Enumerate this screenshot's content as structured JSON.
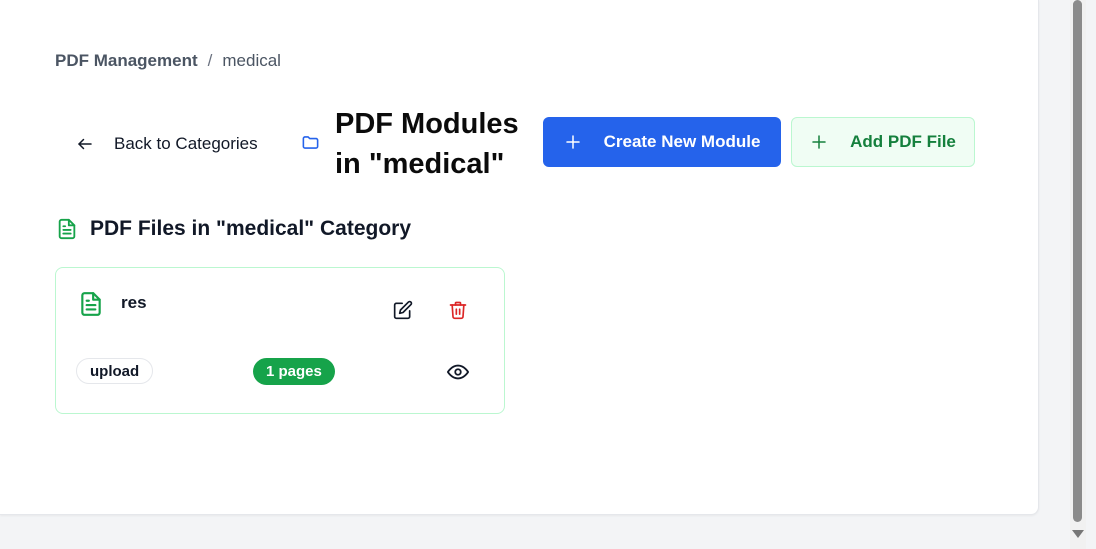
{
  "breadcrumb": {
    "root": "PDF Management",
    "separator": "/",
    "current": "medical"
  },
  "header": {
    "back_label": "Back to Categories",
    "title": "PDF Modules in \"medical\"",
    "create_label": "Create New Module",
    "add_label": "Add PDF File"
  },
  "section": {
    "heading": "PDF Files in \"medical\" Category"
  },
  "files": [
    {
      "name": "res",
      "source": "upload",
      "pages": "1 pages"
    }
  ],
  "colors": {
    "primary": "#2563eb",
    "success": "#16a34a",
    "success_light": "#f0fdf4",
    "danger": "#dc2626"
  },
  "icons": {
    "back": "arrow-left-icon",
    "folder": "folder-icon",
    "create": "plus-icon",
    "add": "plus-icon",
    "section": "file-text-icon",
    "file": "file-text-icon",
    "edit": "edit-icon",
    "delete": "trash-icon",
    "view": "eye-icon"
  }
}
